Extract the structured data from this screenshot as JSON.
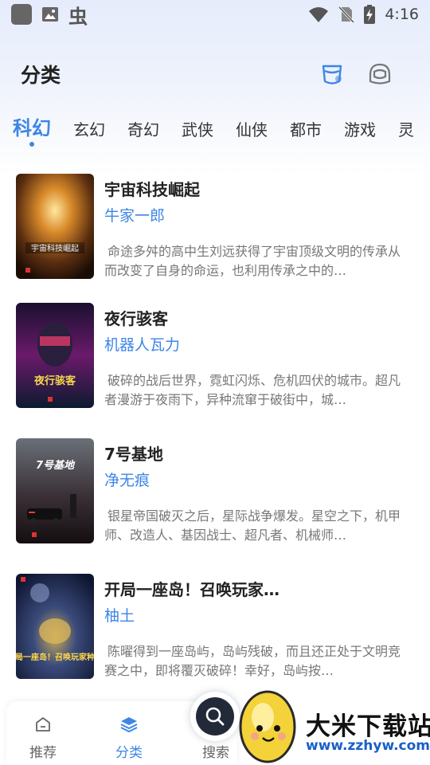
{
  "status_bar": {
    "time": "4:16",
    "icons": [
      "app-icon",
      "image-icon",
      "bug-icon",
      "wifi-icon",
      "no-sim-icon",
      "battery-charging-icon"
    ]
  },
  "header": {
    "title": "分类",
    "icons": [
      "shirt-icon",
      "helmet-icon"
    ]
  },
  "tabs": [
    {
      "label": "科幻",
      "active": true
    },
    {
      "label": "玄幻",
      "active": false
    },
    {
      "label": "奇幻",
      "active": false
    },
    {
      "label": "武侠",
      "active": false
    },
    {
      "label": "仙侠",
      "active": false
    },
    {
      "label": "都市",
      "active": false
    },
    {
      "label": "游戏",
      "active": false
    },
    {
      "label": "灵",
      "active": false
    }
  ],
  "books": [
    {
      "title": "宇宙科技崛起",
      "author": "牛家一郎",
      "description": "命途多舛的高中生刘远获得了宇宙顶级文明的传承从而改变了自身的命运，也利用传承之中的…",
      "cover_text": "宇宙科技崛起"
    },
    {
      "title": "夜行骇客",
      "author": "机器人瓦力",
      "description": "破碎的战后世界，霓虹闪烁、危机四伏的城市。超凡者漫游于夜雨下，异种流窜于破街中，城…",
      "cover_text": "夜行骇客"
    },
    {
      "title": "7号基地",
      "author": "净无痕",
      "description": "银星帝国破灭之后，星际战争爆发。星空之下，机甲师、改造人、基因战士、超凡者、机械师…",
      "cover_text": "7号基地"
    },
    {
      "title": "开局一座岛！召唤玩家…",
      "author": "柚土",
      "description": "陈曜得到一座岛屿，岛屿残破，而且还正处于文明竞赛之中，即将覆灭破碎！幸好，岛屿按…",
      "cover_text": "开局一座岛！召唤玩家种田"
    }
  ],
  "bottom_nav": {
    "items": [
      {
        "label": "推荐",
        "icon": "home-icon",
        "active": false
      },
      {
        "label": "分类",
        "icon": "layers-icon",
        "active": true
      }
    ],
    "search_label": "搜索"
  },
  "watermark": {
    "title": "大米下载站",
    "url": "www.zzhyw.com"
  },
  "colors": {
    "accent": "#3d86e6",
    "text": "#222222",
    "muted": "#777777"
  }
}
